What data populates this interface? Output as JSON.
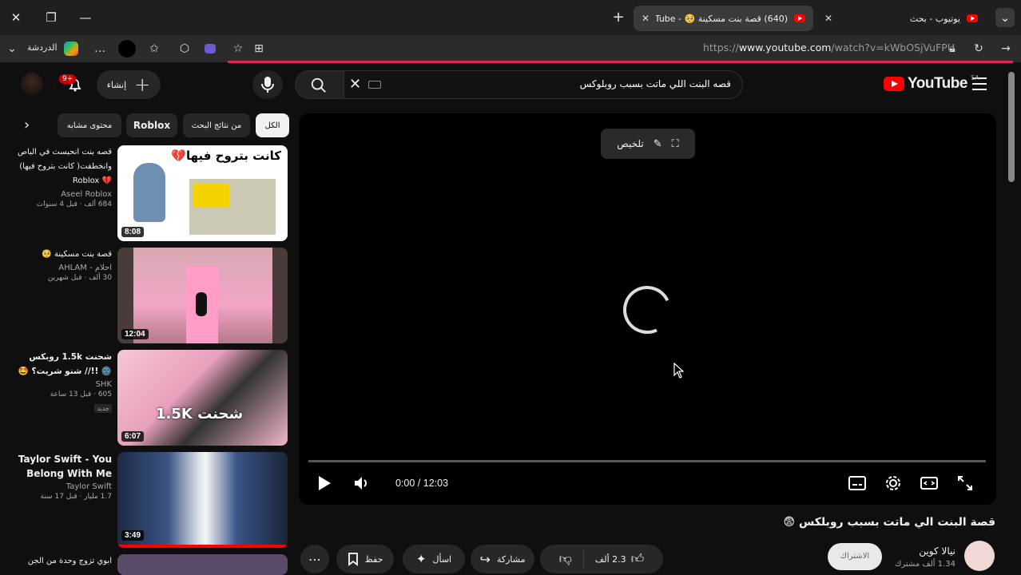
{
  "browser": {
    "tabs": [
      {
        "title": "(640) قصة بنت مسكينة 🥺 - YouTube",
        "active": true
      },
      {
        "title": "يوتيوب - بحث",
        "active": false
      }
    ],
    "url_prefix": "https://",
    "url_domain": "www.youtube.com",
    "url_path": "/watch?v=kWbOSjVuFPU",
    "chat_label": "الدردشة",
    "more_label": "…"
  },
  "header": {
    "logo_text": "YouTube",
    "country_code": "SA",
    "search_query": "قصه البنت اللي ماتت بسبب روبلوكس",
    "create_label": "إنشاء",
    "notification_count": "9+"
  },
  "player": {
    "summary_label": "تلخيص",
    "time": "0:00 / 12:03",
    "progress_fraction": 0
  },
  "video": {
    "title": "قصة البنت الي ماتت بسبب روبلكس 😨",
    "channel_name": "نيالا كوين",
    "channel_subs": "1.34 ألف مشترك",
    "subscribe_label": "الاشتراك",
    "likes": "2.3 ألف",
    "share_label": "مشاركة",
    "ask_label": "اسأل",
    "save_label": "حفظ"
  },
  "chips": [
    {
      "label": "الكل",
      "selected": true
    },
    {
      "label": "من نتائج البحث",
      "selected": false
    },
    {
      "label": "Roblox",
      "selected": false
    },
    {
      "label": "محتوى مشابه",
      "selected": false
    }
  ],
  "recommendations": [
    {
      "title": "قصه بنت انحبست في الباص وانخطفت( كانت بتروح فيها) 💔 Roblox",
      "channel": "Aseel Roblox",
      "meta": "684 ألف · قبل 4 سنوات",
      "duration": "8:08",
      "thumb_text": "كانت بتروح فيها💔"
    },
    {
      "title": "قصة بنت مسكينة 🥺",
      "channel": "احلام - AHLAM",
      "meta": "30 ألف · قبل شهرين",
      "duration": "12:04",
      "thumb_text": ""
    },
    {
      "title": "شحنت 1.5k روبكس 🌚 !!// شنو شريت؟ 🤩",
      "channel": "SHK",
      "meta": "605 · قبل 13 ساعة",
      "duration": "6:07",
      "badge": "جديد",
      "thumb_text": "شحنت 1.5K"
    },
    {
      "title": "Taylor Swift - You Belong With Me",
      "channel": "Taylor Swift",
      "meta": "1.7 مليار · قبل 17 سنة",
      "duration": "3:49",
      "thumb_text": ""
    },
    {
      "title": "ابوي تزوج وحدة من الجن",
      "channel": "",
      "meta": "",
      "duration": "",
      "thumb_text": ""
    }
  ]
}
